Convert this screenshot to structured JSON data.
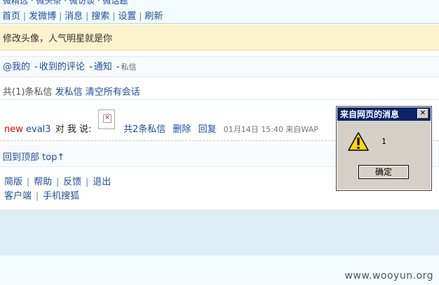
{
  "top_partial": "微精选 · 微头条 · 微访谈 · 微话题",
  "nav": {
    "items": [
      "首页",
      "发微博",
      "消息",
      "搜索",
      "设置",
      "刷新"
    ]
  },
  "notice": {
    "text": "修改头像，人气明星就是你"
  },
  "msgnav": {
    "at": "@我的",
    "comments": "收到的评论",
    "notify": "通知",
    "private": "私信"
  },
  "summary": {
    "count": "共(1)条私信",
    "send": "发私信",
    "clear": "清空所有会话"
  },
  "message": {
    "new": "new",
    "user": "eval3",
    "says": "对 我 说:",
    "total": "共2条私信",
    "delete": "删除",
    "reply": "回复",
    "meta": "01月14日 15:40 来自WAP"
  },
  "back_to_top": "回到顶部 top↑",
  "footer": {
    "row1": [
      "简版",
      "帮助",
      "反馈",
      "退出"
    ],
    "row2": [
      "客户端",
      "手机搜狐"
    ]
  },
  "dialog": {
    "title": "来自网页的消息",
    "message": "1",
    "ok": "确定"
  },
  "watermark": "www.wooyun.org"
}
